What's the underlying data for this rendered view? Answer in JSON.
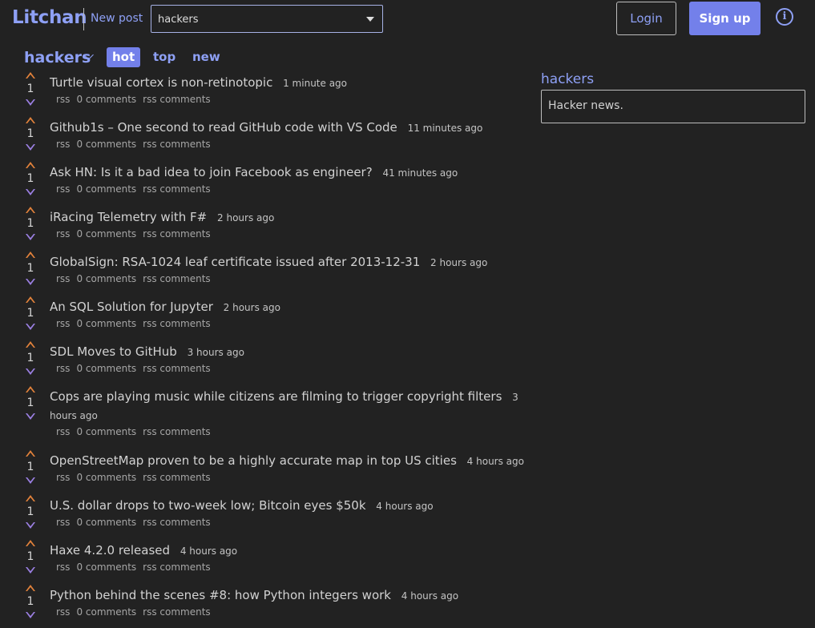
{
  "app": {
    "name": "Litchan",
    "new_post": "New post"
  },
  "community_select": {
    "value": "hackers"
  },
  "auth": {
    "login": "Login",
    "signup": "Sign up",
    "info": "i"
  },
  "community": {
    "name": "hackers"
  },
  "tabs": [
    {
      "label": "hot",
      "active": true
    },
    {
      "label": "top",
      "active": false
    },
    {
      "label": "new",
      "active": false
    }
  ],
  "sidebar": {
    "title": "hackers",
    "description": "Hacker news."
  },
  "posts": [
    {
      "score": "1",
      "title": "Turtle visual cortex is non-retinotopic",
      "time": "1 minute ago",
      "links": [
        "rss",
        "0 comments",
        "rss comments"
      ]
    },
    {
      "score": "1",
      "title": "Github1s – One second to read GitHub code with VS Code",
      "time": "11 minutes ago",
      "links": [
        "rss",
        "0 comments",
        "rss comments"
      ]
    },
    {
      "score": "1",
      "title": "Ask HN: Is it a bad idea to join Facebook as engineer?",
      "time": "41 minutes ago",
      "links": [
        "rss",
        "0 comments",
        "rss comments"
      ]
    },
    {
      "score": "1",
      "title": "iRacing Telemetry with F#",
      "time": "2 hours ago",
      "links": [
        "rss",
        "0 comments",
        "rss comments"
      ]
    },
    {
      "score": "1",
      "title": "GlobalSign: RSA-1024 leaf certificate issued after 2013-12-31",
      "time": "2 hours ago",
      "links": [
        "rss",
        "0 comments",
        "rss comments"
      ]
    },
    {
      "score": "1",
      "title": "An SQL Solution for Jupyter",
      "time": "2 hours ago",
      "links": [
        "rss",
        "0 comments",
        "rss comments"
      ]
    },
    {
      "score": "1",
      "title": "SDL Moves to GitHub",
      "time": "3 hours ago",
      "links": [
        "rss",
        "0 comments",
        "rss comments"
      ]
    },
    {
      "score": "1",
      "title": "Cops are playing music while citizens are filming to trigger copyright filters",
      "time": "3 hours ago",
      "links": [
        "rss",
        "0 comments",
        "rss comments"
      ]
    },
    {
      "score": "1",
      "title": "OpenStreetMap proven to be a highly accurate map in top US cities",
      "time": "4 hours ago",
      "links": [
        "rss",
        "0 comments",
        "rss comments"
      ]
    },
    {
      "score": "1",
      "title": "U.S. dollar drops to two-week low; Bitcoin eyes $50k",
      "time": "4 hours ago",
      "links": [
        "rss",
        "0 comments",
        "rss comments"
      ]
    },
    {
      "score": "1",
      "title": "Haxe 4.2.0 released",
      "time": "4 hours ago",
      "links": [
        "rss",
        "0 comments",
        "rss comments"
      ]
    },
    {
      "score": "1",
      "title": "Python behind the scenes #8: how Python integers work",
      "time": "4 hours ago",
      "links": [
        "rss",
        "0 comments",
        "rss comments"
      ]
    }
  ],
  "colors": {
    "accent": "#8ea0f5",
    "primary": "#7380ea",
    "upvote": "#e2823b",
    "downvote": "#9b7fe2",
    "background": "#222222"
  }
}
